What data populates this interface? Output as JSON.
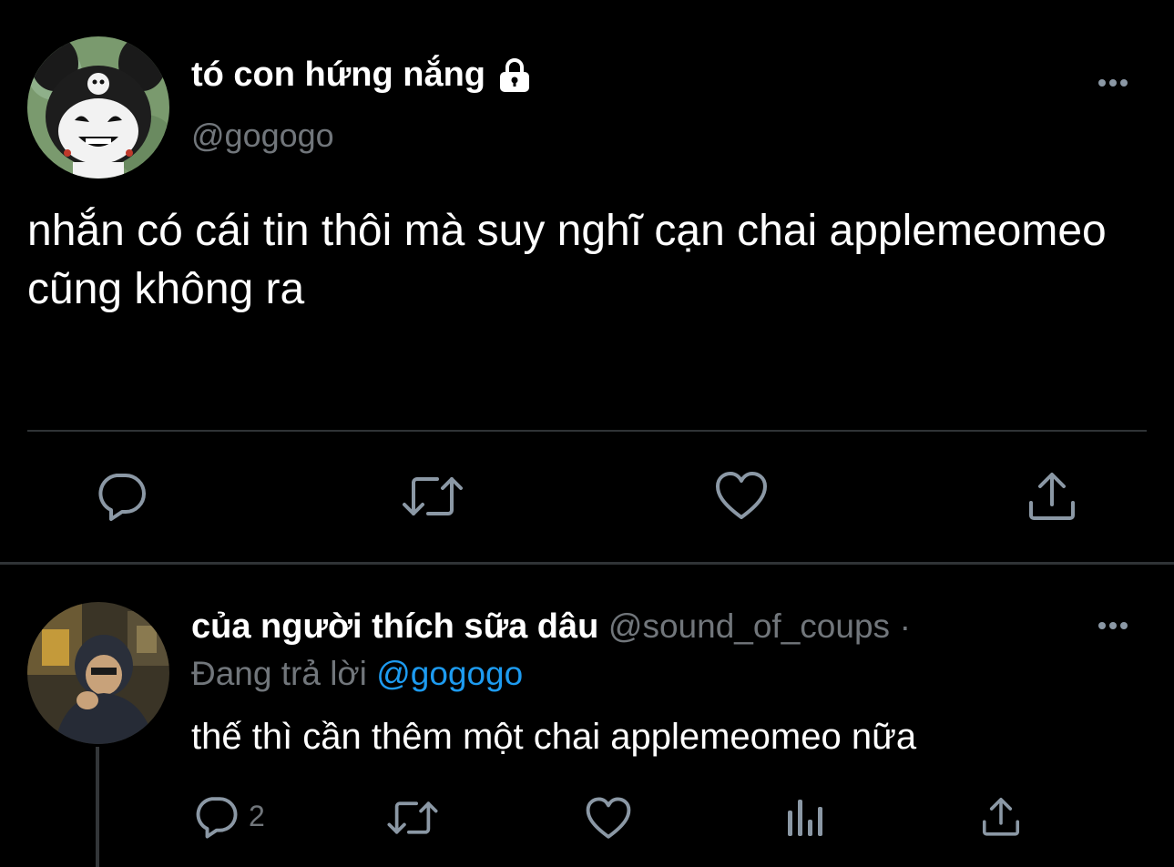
{
  "main_tweet": {
    "display_name": "tó con hứng nắng",
    "handle": "@gogogo",
    "text": "nhắn có cái tin thôi mà suy nghĩ cạn chai applemeomeo cũng không ra",
    "icons": {
      "lock": "lock-icon",
      "more": "more-icon",
      "reply": "reply-icon",
      "retweet": "retweet-icon",
      "like": "heart-icon",
      "share": "share-icon"
    }
  },
  "reply_tweet": {
    "display_name": "của người thích sữa dâu",
    "handle": "@sound_of_coups",
    "separator": "·",
    "replying_prefix": "Đang trả lời",
    "replying_mention": "@gogogo",
    "text": "thế thì cần thêm một chai applemeomeo nữa",
    "reply_count": "2",
    "icons": {
      "more": "more-icon",
      "reply": "reply-icon",
      "retweet": "retweet-icon",
      "like": "heart-icon",
      "analytics": "analytics-icon",
      "share": "share-icon"
    }
  },
  "colors": {
    "background": "#000000",
    "primary_text": "#ffffff",
    "secondary_text": "#71767b",
    "icon": "#8b98a5",
    "link": "#1d9bf0",
    "divider": "#2f3336"
  }
}
